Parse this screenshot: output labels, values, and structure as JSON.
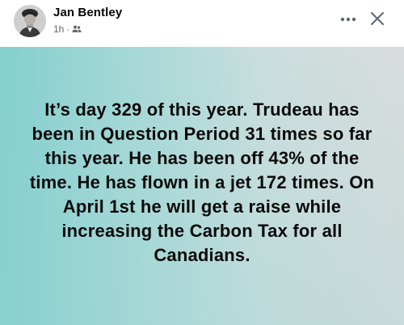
{
  "post": {
    "author_name": "Jan Bentley",
    "timestamp": "1h",
    "separator": "·",
    "audience_icon": "friends-icon",
    "more_icon": "more-horizontal-icon",
    "close_icon": "close-icon",
    "text": "It’s day 329 of this year. Trudeau has been in Question Period 31 times so far this year. He has been off 43% of the time. He has flown in a jet 172 times. On April 1st he will get a raise while increasing the Carbon Tax for all Canadians."
  },
  "colors": {
    "background_left": "#84cfcf",
    "background_right": "#d9dcdc",
    "text": "#0a0a0a",
    "meta": "#65676b"
  }
}
